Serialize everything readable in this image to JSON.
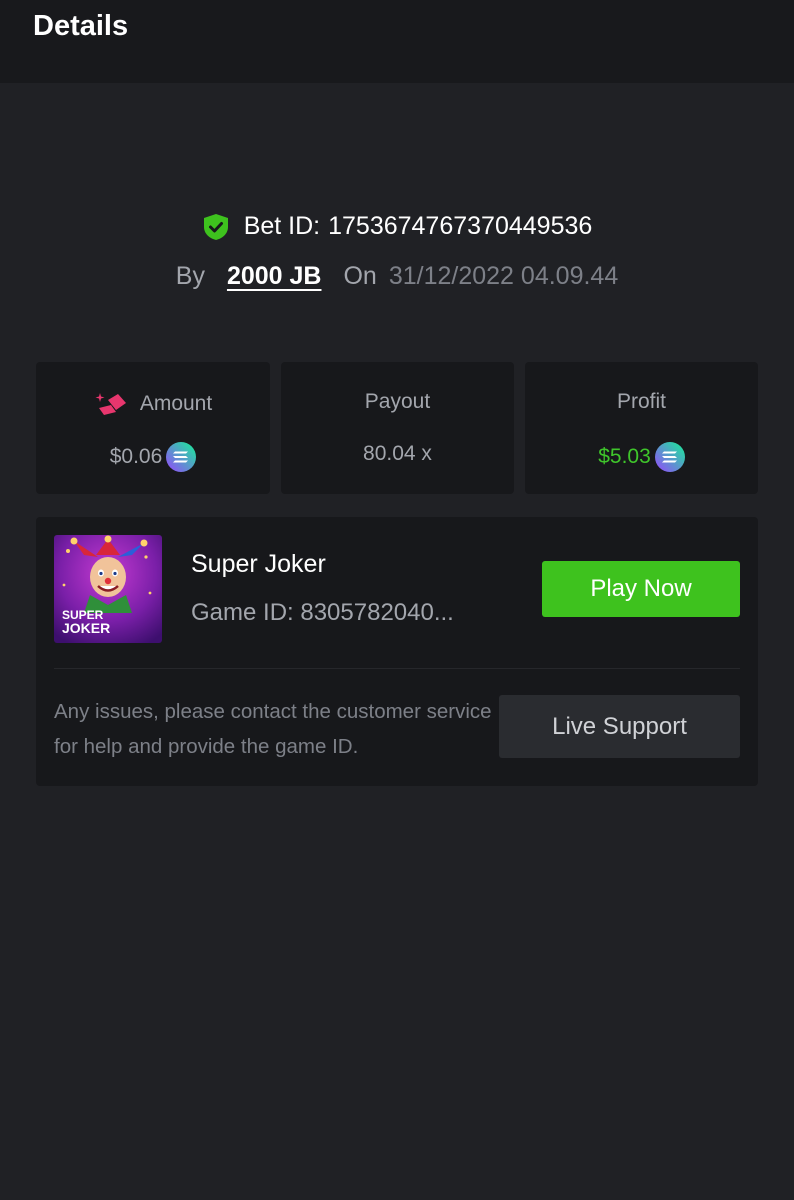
{
  "header": {
    "title": "Details"
  },
  "bet": {
    "id_label": "Bet ID:",
    "id_value": "1753674767370449536",
    "by_label": "By",
    "user": "2000 JB",
    "on_label": "On",
    "datetime": "31/12/2022 04.09.44",
    "verified_icon": "shield-check-icon"
  },
  "stats": {
    "amount": {
      "label": "Amount",
      "value": "$0.06",
      "icon": "amount-icon",
      "coin": "solana-coin-icon"
    },
    "payout": {
      "label": "Payout",
      "value": "80.04 x"
    },
    "profit": {
      "label": "Profit",
      "value": "$5.03",
      "color": "#3fc52b",
      "coin": "solana-coin-icon"
    }
  },
  "game": {
    "thumb_text_line1": "SUPER",
    "thumb_text_line2": "JOKER",
    "name": "Super Joker",
    "id_text": "Game ID: 8305782040...",
    "play_label": "Play Now",
    "help_text": "Any issues, please contact the customer service for help and provide the game ID.",
    "support_label": "Live Support"
  },
  "colors": {
    "background": "#202125",
    "card": "#17181b",
    "accent_green": "#3ec21e",
    "profit_green": "#3fc52b"
  }
}
